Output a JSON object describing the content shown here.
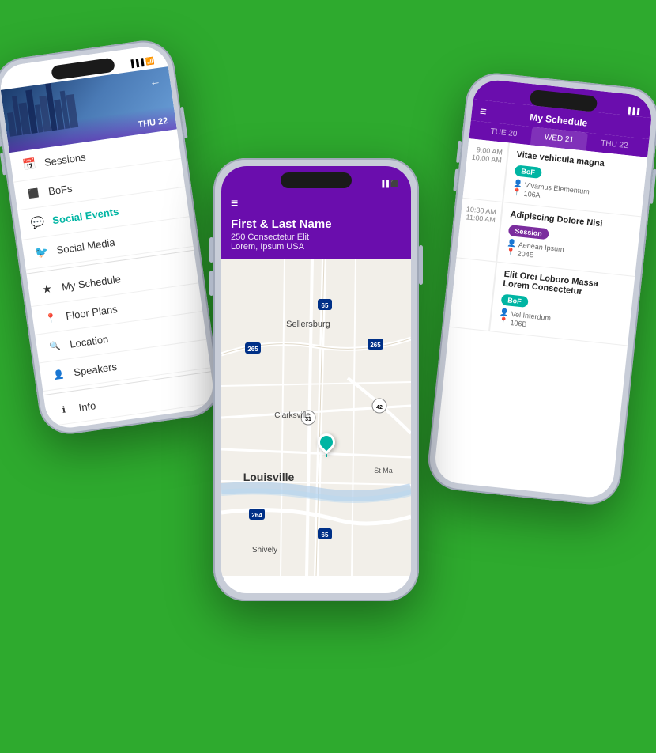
{
  "background_color": "#2eaa2e",
  "phone1": {
    "type": "menu",
    "header": {
      "back_label": "←",
      "day_label": "THU 22"
    },
    "menu_items": [
      {
        "id": "sessions",
        "label": "Sessions",
        "icon": "📅",
        "active": false
      },
      {
        "id": "bofs",
        "label": "BoFs",
        "icon": "⬜",
        "active": false
      },
      {
        "id": "social-events",
        "label": "Social Events",
        "icon": "💬",
        "active": true
      },
      {
        "id": "social-media",
        "label": "Social Media",
        "icon": "🐦",
        "active": false
      },
      {
        "id": "my-schedule",
        "label": "My Schedule",
        "icon": "★",
        "active": false
      },
      {
        "id": "floor-plans",
        "label": "Floor Plans",
        "icon": "📍",
        "active": false
      },
      {
        "id": "location",
        "label": "Location",
        "icon": "🔍",
        "active": false
      },
      {
        "id": "speakers",
        "label": "Speakers",
        "icon": "👤",
        "active": false
      },
      {
        "id": "info",
        "label": "Info",
        "icon": "ℹ",
        "active": false
      }
    ]
  },
  "phone2": {
    "type": "map",
    "header": {
      "menu_icon": "≡",
      "title": "First & Last Name",
      "address_line1": "250 Consectetur Elit",
      "address_line2": "Lorem, Ipsum USA"
    },
    "map": {
      "city": "Louisville",
      "nearby": [
        "Sellersburg",
        "Clarksville",
        "St Ma",
        "Shively"
      ],
      "highways": [
        "65",
        "265",
        "265",
        "31",
        "42",
        "264"
      ],
      "pin_label": "Louisville"
    }
  },
  "phone3": {
    "type": "schedule",
    "header": {
      "menu_icon": "≡",
      "title": "My Schedule"
    },
    "tabs": [
      {
        "label": "TUE 20",
        "active": false
      },
      {
        "label": "WED 21",
        "active": true
      },
      {
        "label": "THU 22",
        "active": false
      }
    ],
    "schedule_items": [
      {
        "time_start": "9:00 AM",
        "time_end": "10:00 AM",
        "title": "Vitae vehicula magna",
        "badge": "BoF",
        "badge_type": "bof",
        "presenter": "Vivamus Elementum",
        "room": "106A"
      },
      {
        "time_start": "10:30 AM",
        "time_end": "11:00 AM",
        "title": "Adipiscing Dolore Nisi",
        "badge": "Session",
        "badge_type": "session",
        "presenter": "Aenean Ipsum",
        "room": "204B"
      },
      {
        "time_start": "",
        "time_end": "",
        "title": "Elit Orci Loboro Massa Lorem Consectetur",
        "badge": "BoF",
        "badge_type": "bof",
        "presenter": "Vel Interdum",
        "room": "106B"
      }
    ]
  }
}
